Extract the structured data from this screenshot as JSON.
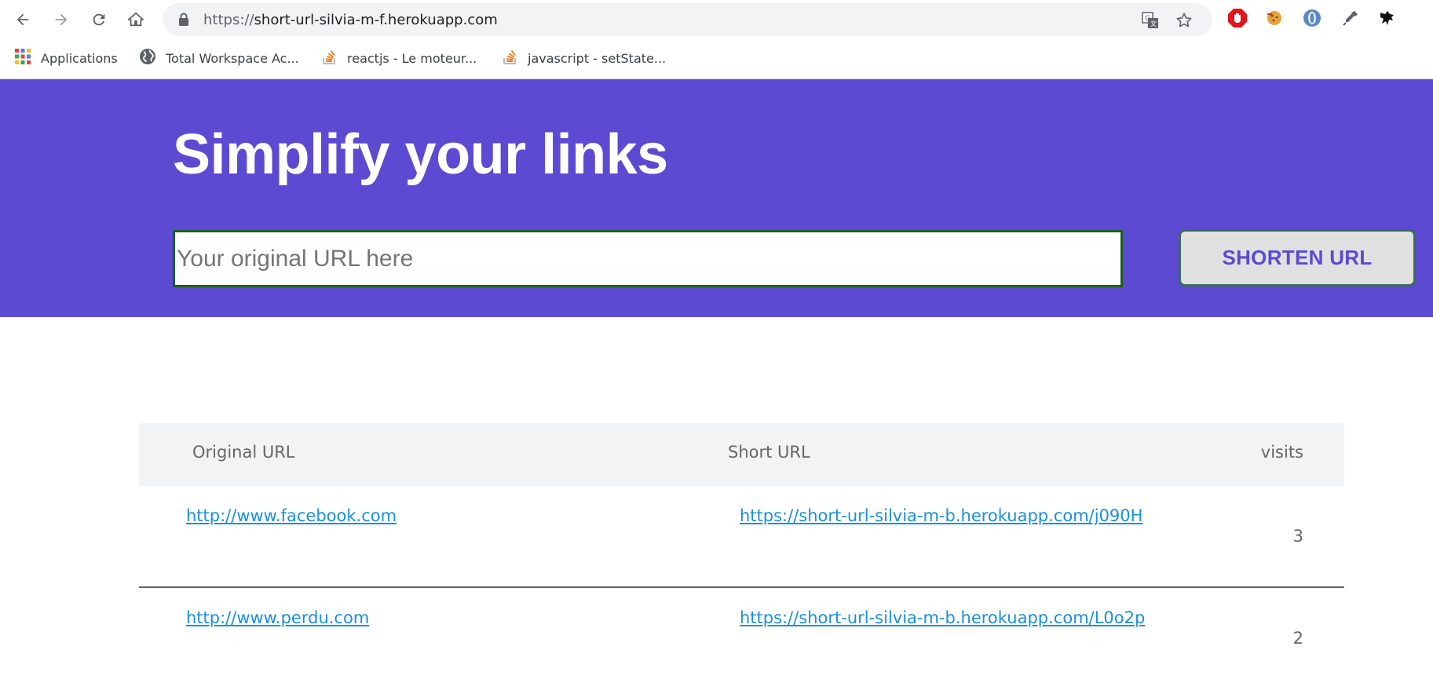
{
  "browser": {
    "url_scheme": "https://",
    "url_host": "short-url-silvia-m-f.herokuapp.com",
    "bookmarks": [
      {
        "label": "Applications",
        "icon": "apps-grid-icon"
      },
      {
        "label": "Total Workspace Ac...",
        "icon": "globe-icon"
      },
      {
        "label": "reactjs - Le moteur...",
        "icon": "stackoverflow-icon"
      },
      {
        "label": "javascript - setState...",
        "icon": "stackoverflow-icon"
      }
    ],
    "extensions": [
      "adblock-icon",
      "cookie-icon",
      "opera-icon",
      "eyedropper-icon",
      "bird-icon"
    ]
  },
  "hero": {
    "title": "Simplify your links",
    "input_placeholder": "Your original URL here",
    "input_value": "",
    "button_label": "SHORTEN URL",
    "background": "#5c4ad2"
  },
  "table": {
    "headers": {
      "original": "Original URL",
      "short": "Short URL",
      "visits": "visits"
    },
    "rows": [
      {
        "original": "http://www.facebook.com",
        "short": "https://short-url-silvia-m-b.herokuapp.com/j090H",
        "visits": "3"
      },
      {
        "original": "http://www.perdu.com",
        "short": "https://short-url-silvia-m-b.herokuapp.com/L0o2p",
        "visits": "2"
      }
    ]
  },
  "colors": {
    "accent": "#5c4ad2",
    "link": "#1a8fdc",
    "input_border": "#1b5e20"
  }
}
